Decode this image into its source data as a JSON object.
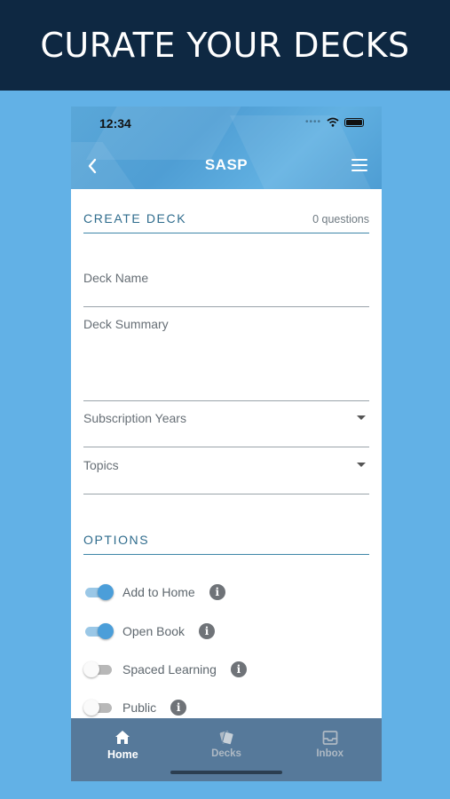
{
  "banner": {
    "title": "CURATE YOUR DECKS"
  },
  "status_bar": {
    "time": "12:34",
    "signal_dots": "••••"
  },
  "nav": {
    "title": "SASP",
    "back_icon": "chevron-left-icon",
    "menu_icon": "hamburger-menu-icon"
  },
  "create_deck": {
    "title": "CREATE DECK",
    "question_count": "0 questions",
    "fields": {
      "deck_name": "Deck Name",
      "deck_summary": "Deck Summary",
      "subscription_years": "Subscription Years",
      "topics": "Topics"
    }
  },
  "options": {
    "title": "OPTIONS",
    "info_glyph": "i",
    "items": [
      {
        "label": "Add to Home",
        "on": true
      },
      {
        "label": "Open Book",
        "on": true
      },
      {
        "label": "Spaced Learning",
        "on": false
      },
      {
        "label": "Public",
        "on": false
      }
    ]
  },
  "tabbar": {
    "tabs": [
      {
        "label": "Home",
        "icon": "home-icon",
        "active": true
      },
      {
        "label": "Decks",
        "icon": "decks-icon",
        "active": false
      },
      {
        "label": "Inbox",
        "icon": "inbox-icon",
        "active": false
      }
    ]
  },
  "colors": {
    "background": "#62b1e6",
    "banner": "#0e2842",
    "accent": "#2f6c8d",
    "toggle_on": "#4b9ed9",
    "tabbar": "#56799a"
  }
}
